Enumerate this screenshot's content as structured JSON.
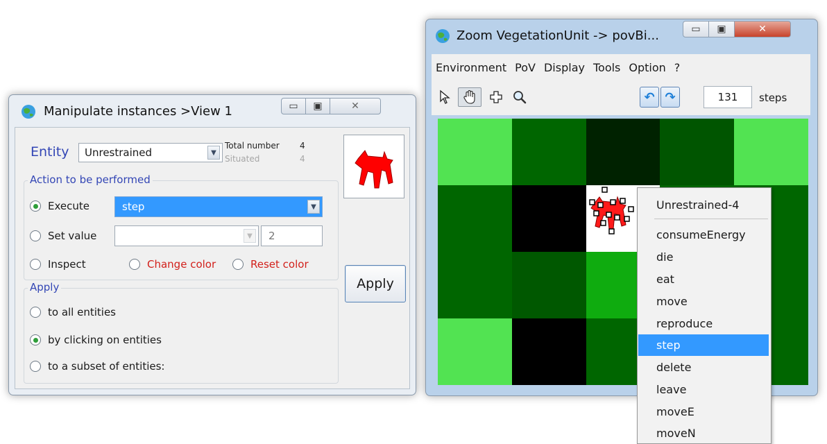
{
  "left_window": {
    "title": "Manipulate instances >View 1",
    "icon": "globe-icon",
    "entity_label": "Entity",
    "entity_value": "Unrestrained",
    "total_number_label": "Total number",
    "total_number_value": "4",
    "situated_label": "Situated",
    "situated_value": "4",
    "action_group_label": "Action to be performed",
    "execute_label": "Execute",
    "execute_value": "step",
    "set_value_label": "Set value",
    "set_value_combo": "",
    "set_value_number": "2",
    "inspect_label": "Inspect",
    "change_color_label": "Change color",
    "reset_color_label": "Reset color",
    "apply_button": "Apply",
    "apply_group_label": "Apply",
    "apply_options": [
      "to all entities",
      "by clicking on entities",
      "to a subset of entities:"
    ],
    "selected_action": "Execute",
    "selected_apply": "by clicking on entities"
  },
  "right_window": {
    "title": "Zoom VegetationUnit -> povBi...",
    "icon": "globe-icon",
    "menu": [
      "Environment",
      "PoV",
      "Display",
      "Tools",
      "Option",
      "?"
    ],
    "steps_value": "131",
    "steps_label": "steps",
    "grid": {
      "rows": 4,
      "cols": 5,
      "colors": [
        [
          "#52e352",
          "#006600",
          "#002200",
          "#005500",
          "#52e352"
        ],
        [
          "#006600",
          "#000000",
          "#ffffff",
          "#006600",
          "#006600"
        ],
        [
          "#006600",
          "#005800",
          "#0fac0f",
          "#006600",
          "#006600"
        ],
        [
          "#52e352",
          "#000000",
          "#006600",
          "#006600",
          "#006600"
        ]
      ]
    }
  },
  "context_menu": {
    "header": "Unrestrained-4",
    "items": [
      "consumeEnergy",
      "die",
      "eat",
      "move",
      "reproduce",
      "step",
      "delete",
      "leave",
      "moveE",
      "moveN"
    ],
    "highlighted": "step"
  }
}
